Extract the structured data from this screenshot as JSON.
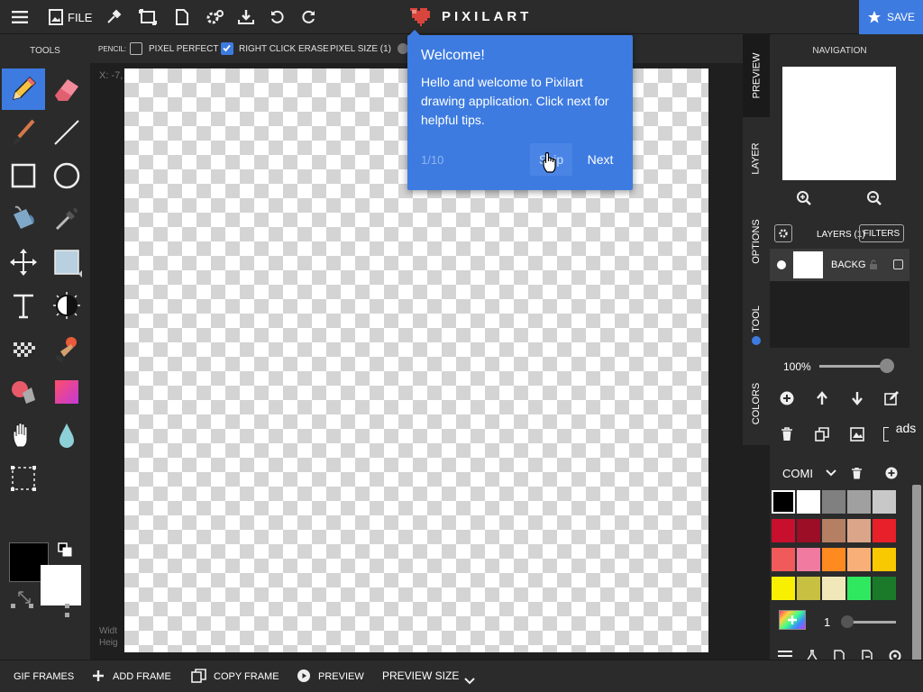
{
  "topbar": {
    "file_label": "FILE",
    "logo_text": "PIXILART",
    "save_label": "SAVE"
  },
  "options_bar": {
    "tool_label": "PENCIL:",
    "pixel_perfect_label": "PIXEL PERFECT",
    "pixel_perfect_checked": false,
    "right_click_erase_label": "RIGHT CLICK ERASE",
    "right_click_erase_checked": true,
    "pixel_size_label": "PIXEL SIZE (1)"
  },
  "tools": {
    "title": "TOOLS",
    "active": "pencil",
    "primary_color": "#000000",
    "secondary_color": "#ffffff"
  },
  "canvas": {
    "coord_text": "X: -7,",
    "width_text": "Widt",
    "height_text": "Heig"
  },
  "tutorial": {
    "title": "Welcome!",
    "body": "Hello and welcome to Pixilart drawing application. Click next for helpful tips.",
    "step": "1/10",
    "skip_label": "Skip",
    "next_label": "Next"
  },
  "side_tabs": [
    "PREVIEW",
    "LAYER",
    "OPTIONS",
    "TOOL",
    "COLORS"
  ],
  "navigation": {
    "title": "NAVIGATION"
  },
  "layers": {
    "title": "LAYERS (1)",
    "filters_label": "FILTERS",
    "items": [
      {
        "name": "BACKG"
      }
    ],
    "opacity": "100%"
  },
  "ads_label": "ads",
  "palette": {
    "name": "COMI",
    "rows": [
      [
        "#000000",
        "#ffffff",
        "#808080",
        "#a0a0a0",
        "#c8c8c8"
      ],
      [
        "#c8102e",
        "#9b0e25",
        "#b57f63",
        "#dba58a",
        "#e8202a"
      ],
      [
        "#f05a5a",
        "#f07aa0",
        "#ff8a20",
        "#f8b078",
        "#f8c800"
      ],
      [
        "#f8f000",
        "#c8c040",
        "#f0e8b8",
        "#30e860",
        "#1a7a2a"
      ]
    ],
    "brush_size": "1"
  },
  "bottombar": {
    "gif_frames": "GIF FRAMES",
    "add_frame": "ADD FRAME",
    "copy_frame": "COPY FRAME",
    "preview": "PREVIEW",
    "preview_size": "PREVIEW SIZE"
  }
}
